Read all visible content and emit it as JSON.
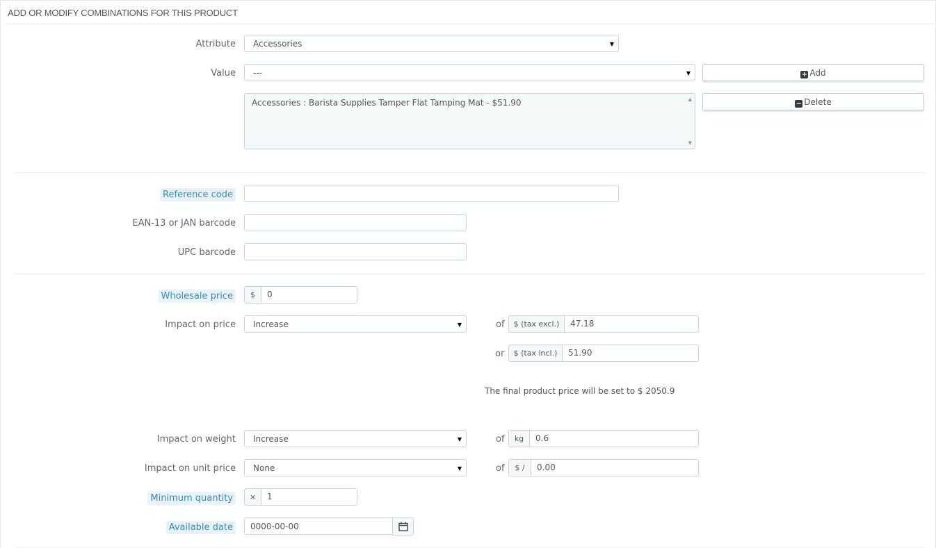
{
  "panel": {
    "heading": "ADD OR MODIFY COMBINATIONS FOR THIS PRODUCT"
  },
  "attribute": {
    "label": "Attribute",
    "selected": "Accessories"
  },
  "value": {
    "label": "Value",
    "selected": "---"
  },
  "buttons": {
    "add": "Add",
    "delete": "Delete"
  },
  "combination_list": {
    "items": [
      "Accessories : Barista Supplies Tamper Flat Tamping Mat - $51.90"
    ]
  },
  "reference": {
    "label": "Reference code",
    "value": ""
  },
  "ean13": {
    "label": "EAN-13 or JAN barcode",
    "value": ""
  },
  "upc": {
    "label": "UPC barcode",
    "value": ""
  },
  "wholesale": {
    "label": "Wholesale price",
    "currency": "$",
    "value": "0"
  },
  "impact_price": {
    "label": "Impact on price",
    "selected": "Increase",
    "of_label": "of",
    "or_label": "or",
    "tax_excl_addon": "$ (tax excl.)",
    "tax_excl_value": "47.18",
    "tax_incl_addon": "$ (tax incl.)",
    "tax_incl_value": "51.90"
  },
  "final_price_note": "The final product price will be set to $ 2050.9",
  "impact_weight": {
    "label": "Impact on weight",
    "selected": "Increase",
    "of_label": "of",
    "unit": "kg",
    "value": "0.6"
  },
  "impact_unit_price": {
    "label": "Impact on unit price",
    "selected": "None",
    "of_label": "of",
    "unit": "$ /",
    "value": "0.00"
  },
  "min_quantity": {
    "label": "Minimum quantity",
    "addon": "×",
    "value": "1"
  },
  "available_date": {
    "label": "Available date",
    "value": "0000-00-00"
  }
}
